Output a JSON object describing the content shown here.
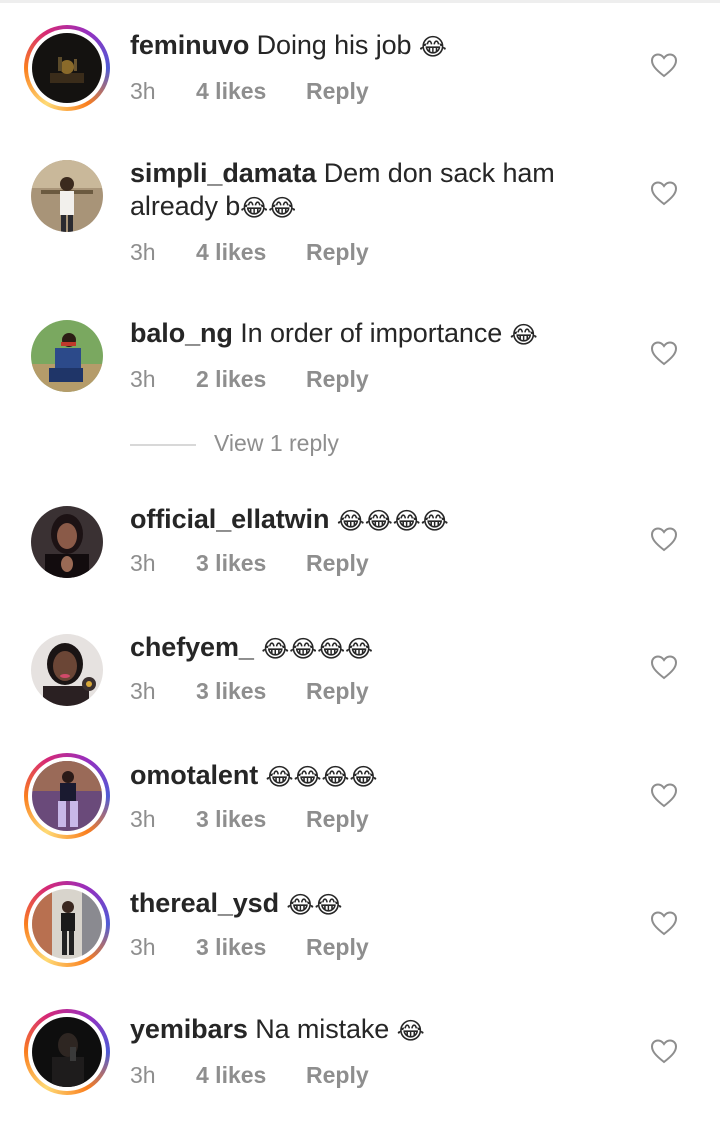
{
  "view_replies": "View 1 reply",
  "comments": [
    {
      "username": "feminuvo",
      "text": "Doing his job",
      "emoji": "😂",
      "time": "3h",
      "likes": "4 likes",
      "reply": "Reply"
    },
    {
      "username": "simpli_damata",
      "text": "Dem don sack ham already b",
      "emoji": "😂😂",
      "time": "3h",
      "likes": "4 likes",
      "reply": "Reply"
    },
    {
      "username": "balo_ng",
      "text": "In order of importance",
      "emoji": "😂",
      "time": "3h",
      "likes": "2 likes",
      "reply": "Reply"
    },
    {
      "username": "official_ellatwin",
      "text": "",
      "emoji": "😂😂😂😂",
      "time": "3h",
      "likes": "3 likes",
      "reply": "Reply"
    },
    {
      "username": "chefyem_",
      "text": "",
      "emoji": "😂😂😂😂",
      "time": "3h",
      "likes": "3 likes",
      "reply": "Reply"
    },
    {
      "username": "omotalent",
      "text": "",
      "emoji": "😂😂😂😂",
      "time": "3h",
      "likes": "3 likes",
      "reply": "Reply"
    },
    {
      "username": "thereal_ysd",
      "text": "",
      "emoji": "😂😂",
      "time": "3h",
      "likes": "3 likes",
      "reply": "Reply"
    },
    {
      "username": "yemibars",
      "text": "Na mistake",
      "emoji": "😂",
      "time": "3h",
      "likes": "4 likes",
      "reply": "Reply"
    }
  ],
  "icons": {
    "like": "heart-outline-icon"
  },
  "colors": {
    "text": "#262626",
    "meta": "#8e8e8e",
    "story_ring": "#d62976"
  }
}
